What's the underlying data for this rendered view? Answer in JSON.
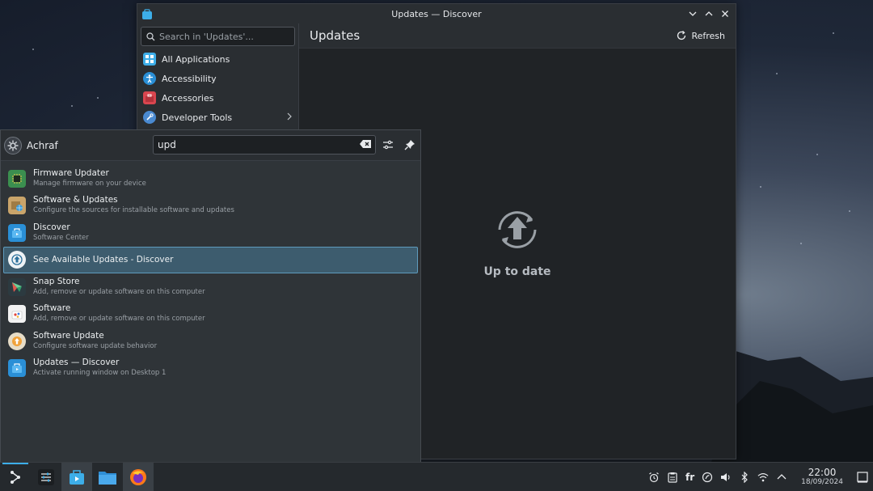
{
  "window": {
    "title": "Updates — Discover",
    "search_placeholder": "Search in 'Updates'...",
    "categories": [
      {
        "label": "All Applications",
        "icon": "grid-icon"
      },
      {
        "label": "Accessibility",
        "icon": "accessibility-icon"
      },
      {
        "label": "Accessories",
        "icon": "toolbox-icon"
      },
      {
        "label": "Developer Tools",
        "icon": "wrench-icon"
      }
    ],
    "main_title": "Updates",
    "refresh_label": "Refresh",
    "status_label": "Up to date"
  },
  "launcher": {
    "user_name": "Achraf",
    "query": "upd",
    "results": [
      {
        "title": "Firmware Updater",
        "subtitle": "Manage firmware on your device",
        "icon": "chip-icon"
      },
      {
        "title": "Software & Updates",
        "subtitle": "Configure the sources for installable software and updates",
        "icon": "package-globe-icon"
      },
      {
        "title": "Discover",
        "subtitle": "Software Center",
        "icon": "discover-icon"
      },
      {
        "title": "See Available Updates - Discover",
        "subtitle": "",
        "icon": "update-icon",
        "selected": true
      },
      {
        "title": "Snap Store",
        "subtitle": "Add, remove or update software on this computer",
        "icon": "snap-icon"
      },
      {
        "title": "Software",
        "subtitle": "Add, remove or update software on this computer",
        "icon": "software-bag-icon"
      },
      {
        "title": "Software Update",
        "subtitle": "Configure software update behavior",
        "icon": "software-update-icon"
      },
      {
        "title": "Updates — Discover",
        "subtitle": "Activate running window on Desktop 1",
        "icon": "discover-icon"
      }
    ]
  },
  "taskbar": {
    "tray_language": "fr",
    "time": "22:00",
    "date": "18/09/2024"
  },
  "colors": {
    "accent": "#3daee9",
    "selection_bg": "#3d5c6e",
    "window_bg": "#202326",
    "panel_bg": "#25292d"
  }
}
